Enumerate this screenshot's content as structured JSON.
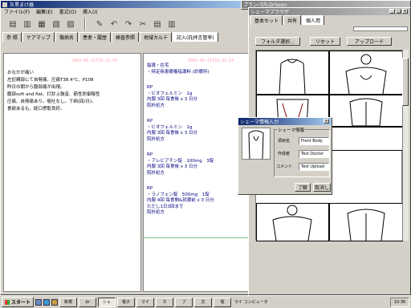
{
  "main_window": {
    "title": "灰黒まけ器",
    "menu": [
      "ファイル(F)",
      "編集(E)",
      "書式(O)",
      "挿入(I)"
    ],
    "tabs": [
      "参 照",
      "ケアマップ",
      "傷病名",
      "患者・履歴",
      "検査参照",
      "地域カルテ",
      "記入(託拝言管率)"
    ]
  },
  "left_note": {
    "timestamp": "2003-09-21T16:31:54",
    "lines": [
      "おなかが痛い",
      "左記親部にて自発痛、圧痛T38.4°C、P108",
      "昨日の朝から腹部痛が出現。",
      "腹部soft and flat、打診上鼓音、筋性防御陰性",
      "圧痛、自発痛あり。嘔吐なし。下痢(回/日)。",
      "食欲あるも、経口摂取良好。"
    ]
  },
  "right_note": {
    "header1": "指導・在宅",
    "header2": "・特定疾患療養指導料 (診療所)",
    "timestamp": "2003-09-21T16:31:54",
    "rx": [
      {
        "rp": "RP",
        "drug": "・ビオフェルミン　1g",
        "dose": "内服 3回 毎食後 x 3 日分",
        "note": "院外処方"
      },
      {
        "rp": "RP",
        "drug": "・ビオフェルミン　1g",
        "dose": "内服 3回 毎食後 x 3 日分",
        "note": "院外処方"
      },
      {
        "rp": "RP",
        "drug": "・アレビアチン錠　100mg　3錠",
        "dose": "内服 3回 毎食後 x 3 日分",
        "note": "院外処方"
      },
      {
        "rp": "RP",
        "drug": "・ラノフェン錠　500mg　1錠",
        "dose": "内服 4回 毎食間&就寝前 x 3 日分",
        "extra": "ただし1日3回まで",
        "note": "院外処方"
      }
    ]
  },
  "schema_window": {
    "title": "シェーマブラウザ",
    "tabs": [
      "基本セット",
      "共有",
      "個人用"
    ],
    "buttons": [
      "フォルダ選択...",
      "リセット",
      "アップロード"
    ]
  },
  "bg_window_title": "プランパ内-DrSoon",
  "dialog": {
    "title": "シェーマ情報入力",
    "group_label": "シェーマ情報",
    "fields": [
      {
        "label": "項目名",
        "value": "Front Body"
      },
      {
        "label": "作成者",
        "value": "Test Doctor"
      },
      {
        "label": "コメント",
        "value": "Test Upload"
      }
    ],
    "ok_label": "了解",
    "cancel_label": "取消し"
  },
  "taskbar": {
    "start_label": "スタート",
    "tasks": [
      "新規",
      "dr",
      "シェ",
      "電子",
      "マイ",
      "カ",
      "ブ",
      "文",
      "電"
    ],
    "active_task": "シェ",
    "my_computer": "マイ コンピュータ",
    "clock": "10:36"
  },
  "colors": {
    "desktop": "#3a6ea5",
    "titlebar_active": "#0a246a",
    "chrome": "#d4d0c8",
    "timestamp": "#ff9fb0"
  }
}
